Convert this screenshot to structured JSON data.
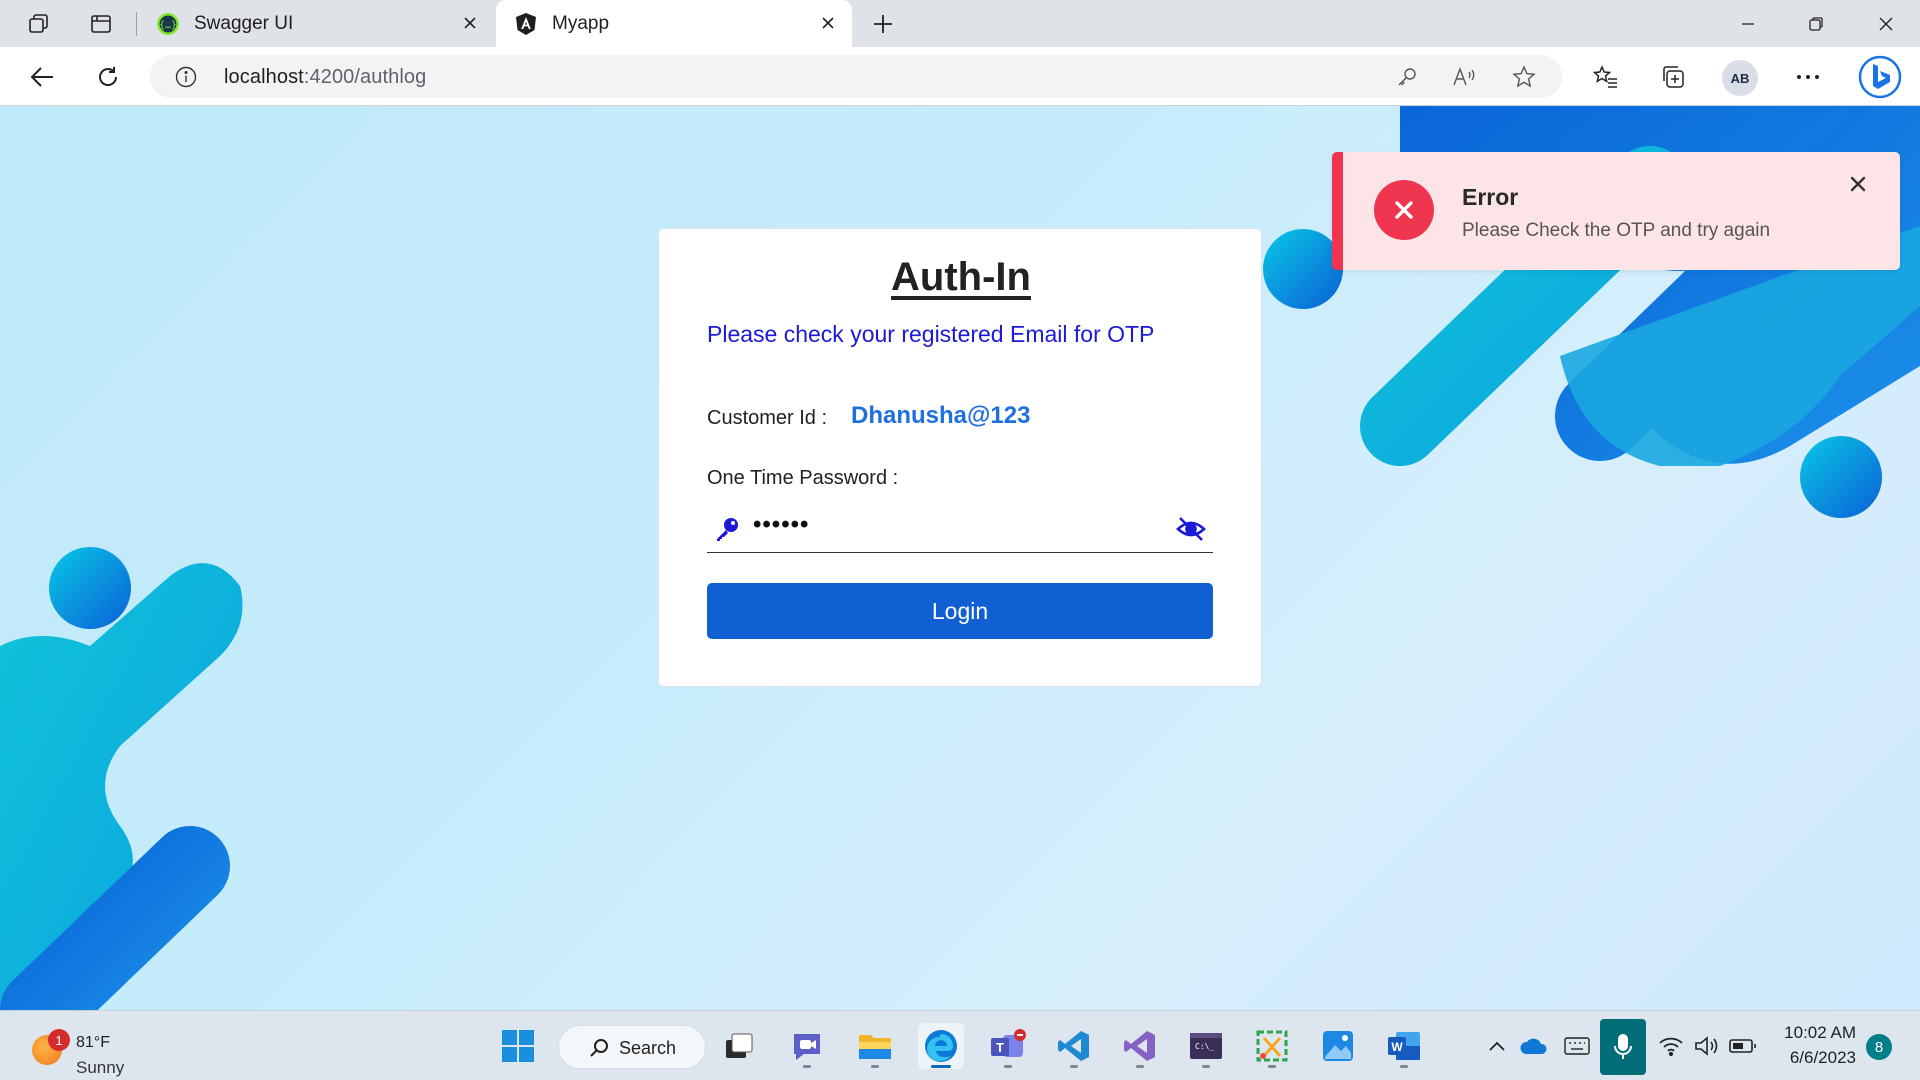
{
  "browser": {
    "tabs": [
      {
        "title": "Swagger UI",
        "icon": "swagger-icon"
      },
      {
        "title": "Myapp",
        "icon": "angular-icon",
        "active": true
      }
    ],
    "url_host": "localhost",
    "url_path": ":4200/authlog",
    "profile_initials": "AB"
  },
  "page": {
    "title": "Auth-In",
    "subtitle": "Please check your registered Email for OTP",
    "customer_label": "Customer Id :",
    "customer_value": "Dhanusha@123",
    "otp_label": "One Time Password :",
    "otp_value": "••••••",
    "login_label": "Login"
  },
  "toast": {
    "title": "Error",
    "message": "Please Check the OTP and try again"
  },
  "taskbar": {
    "weather_temp": "81°F",
    "weather_condition": "Sunny",
    "weather_badge": "1",
    "search_label": "Search",
    "time": "10:02 AM",
    "date": "6/6/2023",
    "notification_count": "8"
  },
  "colors": {
    "accent_blue": "#1060d4",
    "error_red": "#ef3550",
    "subtitle_blue": "#1a1ad8",
    "customer_value_blue": "#1f6fe0"
  }
}
